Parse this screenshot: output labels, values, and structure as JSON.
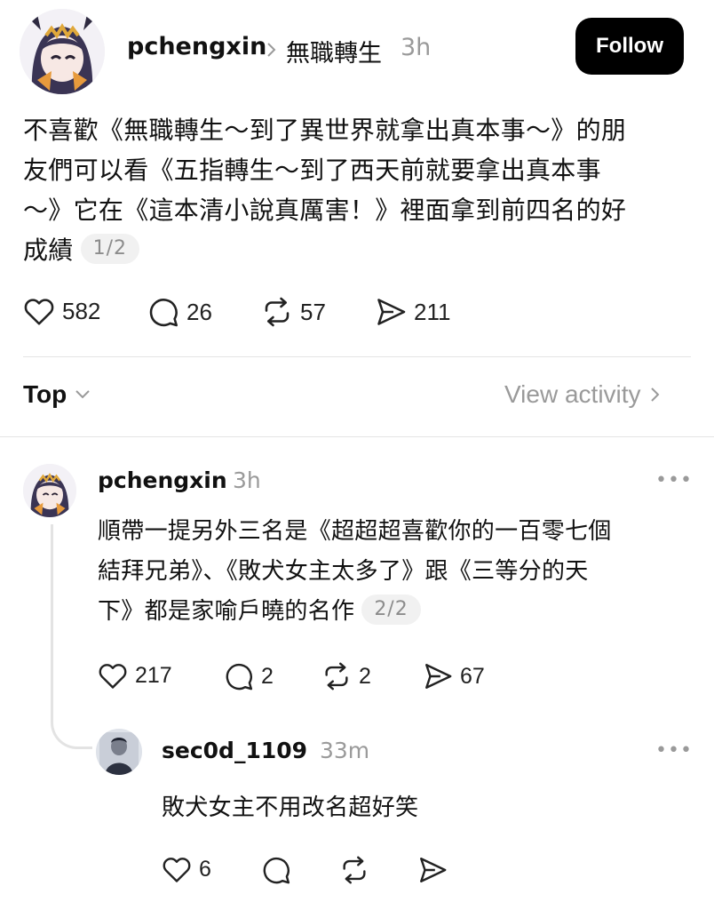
{
  "post": {
    "author": "pchengxin",
    "topic": "無職轉生",
    "time": "3h",
    "follow_label": "Follow",
    "text_lines": [
      "不喜歡《無職轉生～到了異世界就拿出真本事～》的朋",
      "友們可以看《五指轉生～到了西天前就要拿出真本事",
      "～》它在《這本清小說真厲害！》裡面拿到前四名的好",
      "成績"
    ],
    "pager": "1/2",
    "stats": {
      "likes": "582",
      "comments": "26",
      "reposts": "57",
      "shares": "211"
    }
  },
  "sort": {
    "label": "Top",
    "view_activity": "View activity"
  },
  "reply1": {
    "author": "pchengxin",
    "time": "3h",
    "text_lines": [
      "順帶一提另外三名是《超超超喜歡你的一百零七個",
      "結拜兄弟》、《敗犬女主太多了》跟《三等分的天",
      "下》都是家喻戶曉的名作"
    ],
    "pager": "2/2",
    "stats": {
      "likes": "217",
      "comments": "2",
      "reposts": "2",
      "shares": "67"
    }
  },
  "reply2": {
    "author": "sec0d_1109",
    "time": "33m",
    "text": "敗犬女主不用改名超好笑",
    "stats": {
      "likes": "6"
    }
  },
  "icons": {
    "heart": "heart-icon",
    "comment": "comment-bubble-icon",
    "repost": "repost-icon",
    "share": "send-icon",
    "chevron": "chevron-right-icon",
    "dropdown": "chevron-down-icon",
    "more": "more-dots-icon"
  },
  "colors": {
    "text": "#111111",
    "muted": "#9a9a9a",
    "button_bg": "#000000",
    "button_text": "#ffffff",
    "divider": "#e4e4e4"
  }
}
